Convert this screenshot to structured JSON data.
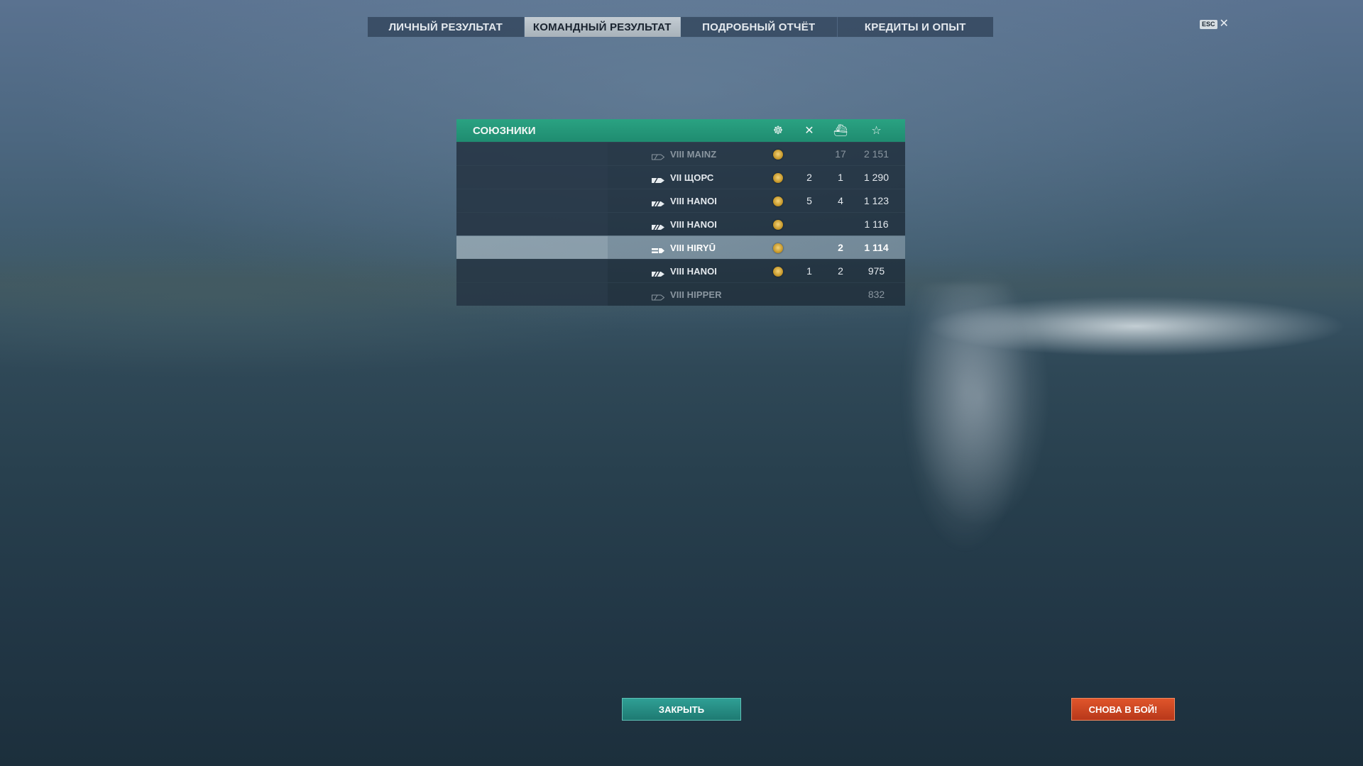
{
  "tabs": [
    {
      "label": "ЛИЧНЫЙ РЕЗУЛЬТАТ",
      "active": false
    },
    {
      "label": "КОМАНДНЫЙ РЕЗУЛЬТАТ",
      "active": true
    },
    {
      "label": "ПОДРОБНЫЙ ОТЧЁТ",
      "active": false
    },
    {
      "label": "КРЕДИТЫ И ОПЫТ",
      "active": false
    }
  ],
  "esc": {
    "key_label": "ESC",
    "close_glyph": "✕"
  },
  "allies": {
    "title": "СОЮЗНИКИ",
    "column_icons": [
      "medal-icon",
      "crossed-swords-icon",
      "ship-sinking-icon",
      "star-icon"
    ],
    "header_glyphs": {
      "medal": "☸",
      "kills": "✕",
      "sunk": "⛴",
      "score": "☆"
    },
    "rows": [
      {
        "ship": "VIII MAINZ",
        "icon": "cruiser-icon-outline",
        "medal": true,
        "kills": "",
        "sunk": "17",
        "score": "2 151",
        "dim": true,
        "highlight": false
      },
      {
        "ship": "VII ЩОРС",
        "icon": "cruiser-icon",
        "medal": true,
        "kills": "2",
        "sunk": "1",
        "score": "1 290",
        "dim": false,
        "highlight": false
      },
      {
        "ship": "VIII HANOI",
        "icon": "destroyer-icon",
        "medal": true,
        "kills": "5",
        "sunk": "4",
        "score": "1 123",
        "dim": false,
        "highlight": false
      },
      {
        "ship": "VIII HANOI",
        "icon": "destroyer-icon",
        "medal": true,
        "kills": "",
        "sunk": "",
        "score": "1 116",
        "dim": false,
        "highlight": false
      },
      {
        "ship": "VIII HIRYŪ",
        "icon": "carrier-icon",
        "medal": true,
        "kills": "",
        "sunk": "2",
        "score": "1 114",
        "dim": false,
        "highlight": true
      },
      {
        "ship": "VIII HANOI",
        "icon": "destroyer-icon",
        "medal": true,
        "kills": "1",
        "sunk": "2",
        "score": "975",
        "dim": false,
        "highlight": false
      },
      {
        "ship": "VIII HIPPER",
        "icon": "cruiser-icon-outline",
        "medal": false,
        "kills": "",
        "sunk": "",
        "score": "832",
        "dim": true,
        "highlight": false
      }
    ]
  },
  "buttons": {
    "close": "ЗАКРЫТЬ",
    "battle_again": "СНОВА В БОЙ!"
  },
  "colors": {
    "allies_header": "#229679",
    "active_tab": "#b7c0c8",
    "close_button": "#26877f",
    "battle_button": "#cc4522"
  }
}
